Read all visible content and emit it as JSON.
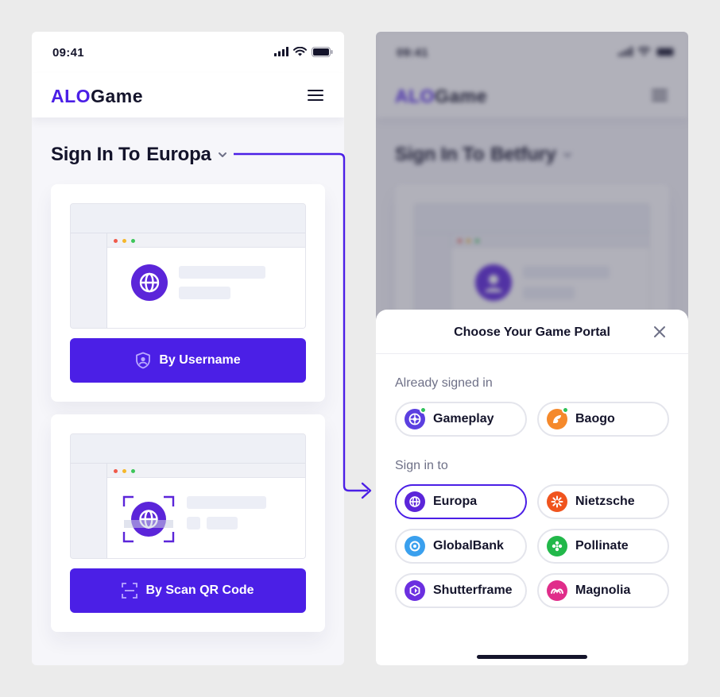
{
  "left_screen": {
    "status_time": "09:41",
    "logo_part1": "ALO",
    "logo_part2": "Game",
    "signin_prefix": "Sign In To",
    "signin_portal": "Europa",
    "username_button": "By Username",
    "qr_button": "By Scan QR Code"
  },
  "right_screen": {
    "status_time": "09:41",
    "logo_part1": "ALO",
    "logo_part2": "Game",
    "signin_prefix": "Sign In To",
    "signin_portal": "Betfury",
    "sheet_title": "Choose Your Game Portal",
    "already_signed_label": "Already signed in",
    "sign_in_label": "Sign in to",
    "signed_in_portals": [
      {
        "name": "Gameplay",
        "icon": "gameplay-icon",
        "color": "#5b3fe0",
        "online": true
      },
      {
        "name": "Baogo",
        "icon": "baogo-icon",
        "color": "#f5892b",
        "online": true
      }
    ],
    "portals": [
      {
        "name": "Europa",
        "icon": "globe-icon",
        "color": "#5b25d9",
        "selected": true
      },
      {
        "name": "Nietzsche",
        "icon": "nietzsche-icon",
        "color": "#f0541e",
        "selected": false
      },
      {
        "name": "GlobalBank",
        "icon": "globalbank-icon",
        "color": "#3aa0ee",
        "selected": false
      },
      {
        "name": "Pollinate",
        "icon": "pollinate-icon",
        "color": "#22b84a",
        "selected": false
      },
      {
        "name": "Shutterframe",
        "icon": "shutterframe-icon",
        "color": "#6b2fe0",
        "selected": false
      },
      {
        "name": "Magnolia",
        "icon": "magnolia-icon",
        "color": "#e02d8a",
        "selected": false
      }
    ]
  },
  "colors": {
    "primary": "#4b1fe6",
    "online": "#2ec15a",
    "text": "#14142b",
    "muted": "#6e7087"
  }
}
